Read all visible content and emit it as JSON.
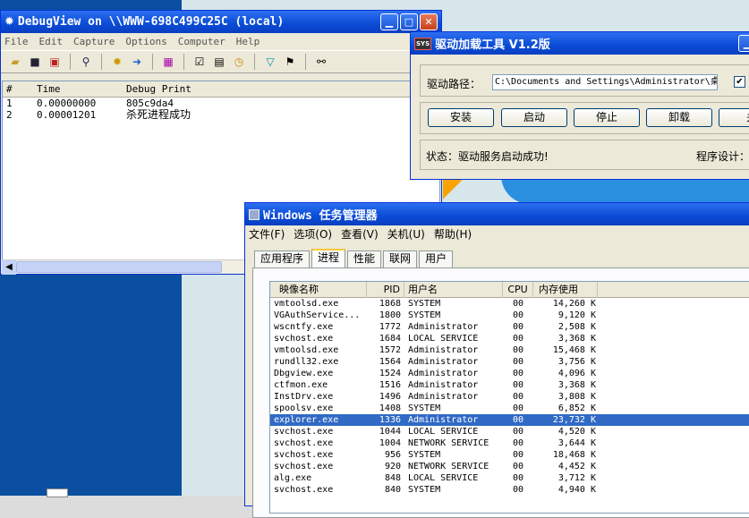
{
  "debugview": {
    "title": "DebugView on \\\\WWW-698C499C25C (local)",
    "menu": [
      "File",
      "Edit",
      "Capture",
      "Options",
      "Computer",
      "Help"
    ],
    "columns": [
      "#",
      "Time",
      "Debug Print"
    ],
    "rows": [
      {
        "n": "1",
        "time": "0.00000000",
        "msg": "805c9da4"
      },
      {
        "n": "2",
        "time": "0.00001201",
        "msg": "杀死进程成功"
      }
    ],
    "toolbar_icons": [
      "open-icon",
      "save-icon",
      "clear-icon",
      "find-icon",
      "capture-icon",
      "autoscroll-icon",
      "highlight-icon",
      "filter-icon",
      "history-icon",
      "timestamp-icon",
      "pin-icon",
      "flag-icon",
      "binoculars-icon"
    ]
  },
  "driver": {
    "title": "驱动加载工具 V1.2版",
    "app_icon_text": "SYS",
    "path_label": "驱动路径：",
    "path_value": "C:\\Documents and Settings\\Administrator\\桌",
    "checkbox_label": "总",
    "buttons": [
      "安装",
      "启动",
      "停止",
      "卸载",
      "关"
    ],
    "status": "状态：驱动服务启动成功!",
    "author_label": "程序设计："
  },
  "taskmgr": {
    "title": "Windows 任务管理器",
    "menu": [
      "文件(F)",
      "选项(O)",
      "查看(V)",
      "关机(U)",
      "帮助(H)"
    ],
    "tabs": [
      "应用程序",
      "进程",
      "性能",
      "联网",
      "用户"
    ],
    "active_tab": "进程",
    "columns": [
      "映像名称",
      "PID",
      "用户名",
      "CPU",
      "内存使用"
    ],
    "processes": [
      {
        "name": "vmtoolsd.exe",
        "pid": "1868",
        "user": "SYSTEM",
        "cpu": "00",
        "mem": "14,260 K"
      },
      {
        "name": "VGAuthService...",
        "pid": "1800",
        "user": "SYSTEM",
        "cpu": "00",
        "mem": "9,120 K"
      },
      {
        "name": "wscntfy.exe",
        "pid": "1772",
        "user": "Administrator",
        "cpu": "00",
        "mem": "2,508 K"
      },
      {
        "name": "svchost.exe",
        "pid": "1684",
        "user": "LOCAL SERVICE",
        "cpu": "00",
        "mem": "3,368 K"
      },
      {
        "name": "vmtoolsd.exe",
        "pid": "1572",
        "user": "Administrator",
        "cpu": "00",
        "mem": "15,468 K"
      },
      {
        "name": "rundll32.exe",
        "pid": "1564",
        "user": "Administrator",
        "cpu": "00",
        "mem": "3,756 K"
      },
      {
        "name": "Dbgview.exe",
        "pid": "1524",
        "user": "Administrator",
        "cpu": "00",
        "mem": "4,096 K"
      },
      {
        "name": "ctfmon.exe",
        "pid": "1516",
        "user": "Administrator",
        "cpu": "00",
        "mem": "3,368 K"
      },
      {
        "name": "InstDrv.exe",
        "pid": "1496",
        "user": "Administrator",
        "cpu": "00",
        "mem": "3,808 K"
      },
      {
        "name": "spoolsv.exe",
        "pid": "1408",
        "user": "SYSTEM",
        "cpu": "00",
        "mem": "6,852 K"
      },
      {
        "name": "explorer.exe",
        "pid": "1336",
        "user": "Administrator",
        "cpu": "00",
        "mem": "23,732 K",
        "selected": true
      },
      {
        "name": "svchost.exe",
        "pid": "1044",
        "user": "LOCAL SERVICE",
        "cpu": "00",
        "mem": "4,520 K"
      },
      {
        "name": "svchost.exe",
        "pid": "1004",
        "user": "NETWORK SERVICE",
        "cpu": "00",
        "mem": "3,644 K"
      },
      {
        "name": "svchost.exe",
        "pid": "956",
        "user": "SYSTEM",
        "cpu": "00",
        "mem": "18,468 K"
      },
      {
        "name": "svchost.exe",
        "pid": "920",
        "user": "NETWORK SERVICE",
        "cpu": "00",
        "mem": "4,452 K"
      },
      {
        "name": "alg.exe",
        "pid": "848",
        "user": "LOCAL SERVICE",
        "cpu": "00",
        "mem": "3,712 K"
      },
      {
        "name": "svchost.exe",
        "pid": "840",
        "user": "SYSTEM",
        "cpu": "00",
        "mem": "4,940 K"
      }
    ]
  }
}
